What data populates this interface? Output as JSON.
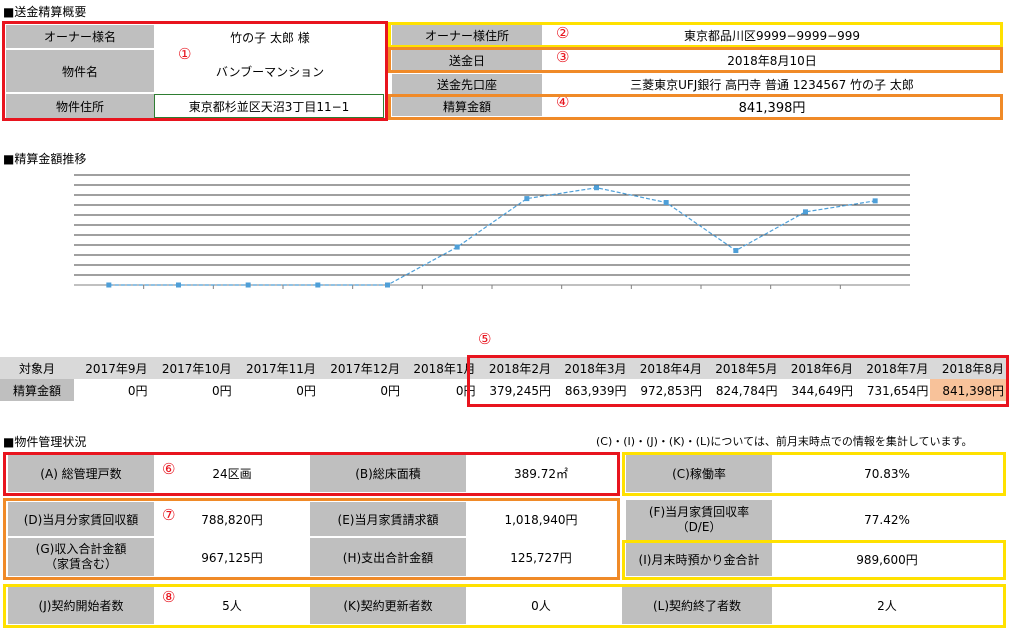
{
  "sections": {
    "remittance_title": "■送金精算概要",
    "trend_title": "■精算金額推移",
    "mgmt_title": "■物件管理状況",
    "mgmt_note": "(C)・(I)・(J)・(K)・(L)については、前月末時点での情報を集計しています。"
  },
  "markers": {
    "m1": "①",
    "m2": "②",
    "m3": "③",
    "m4": "④",
    "m5": "⑤",
    "m6": "⑥",
    "m7": "⑦",
    "m8": "⑧"
  },
  "summary": {
    "owner_name_label": "オーナー様名",
    "owner_name": "竹の子 太郎 様",
    "property_name_label": "物件名",
    "property_name": "バンブーマンション",
    "property_address_label": "物件住所",
    "property_address": "東京都杉並区天沼3丁目11−1",
    "owner_address_label": "オーナー様住所",
    "owner_address": "東京都品川区9999−9999−999",
    "remit_date_label": "送金日",
    "remit_date": "2018年8月10日",
    "remit_account_label": "送金先口座",
    "remit_account": "三菱東京UFJ銀行 高円寺 普通 1234567 竹の子 太郎",
    "settlement_label": "精算金額",
    "settlement_amount": "841,398円"
  },
  "monthly": {
    "row1_label": "対象月",
    "row2_label": "精算金額",
    "months": [
      "2017年9月",
      "2017年10月",
      "2017年11月",
      "2017年12月",
      "2018年1月",
      "2018年2月",
      "2018年3月",
      "2018年4月",
      "2018年5月",
      "2018年6月",
      "2018年7月",
      "2018年8月"
    ],
    "amounts": [
      "0円",
      "0円",
      "0円",
      "0円",
      "0円",
      "379,245円",
      "863,939円",
      "972,853円",
      "824,784円",
      "344,649円",
      "731,654円",
      "841,398円"
    ]
  },
  "chart_data": {
    "type": "line",
    "title": "",
    "xlabel": "",
    "ylabel": "",
    "categories": [
      "2017年9月",
      "2017年10月",
      "2017年11月",
      "2017年12月",
      "2018年1月",
      "2018年2月",
      "2018年3月",
      "2018年4月",
      "2018年5月",
      "2018年6月",
      "2018年7月",
      "2018年8月"
    ],
    "values": [
      0,
      0,
      0,
      0,
      0,
      379245,
      863939,
      972853,
      824784,
      344649,
      731654,
      841398
    ],
    "ylim": [
      0,
      1100000
    ],
    "grid": true,
    "color": "#4e9fd8"
  },
  "management": {
    "a_label": "(A) 総管理戸数",
    "a_value": "24区画",
    "b_label": "(B)総床面積",
    "b_value": "389.72㎡",
    "c_label": "(C)稼働率",
    "c_value": "70.83%",
    "d_label": "(D)当月分家賃回収額",
    "d_value": "788,820円",
    "e_label": "(E)当月家賃請求額",
    "e_value": "1,018,940円",
    "f_label_1": "(F)当月家賃回収率",
    "f_label_2": "（D/E）",
    "f_value": "77.42%",
    "g_label_1": "(G)収入合計金額",
    "g_label_2": "（家賃含む）",
    "g_value": "967,125円",
    "h_label": "(H)支出合計金額",
    "h_value": "125,727円",
    "i_label": "(I)月末時預かり金合計",
    "i_value": "989,600円",
    "j_label": "(J)契約開始者数",
    "j_value": "5人",
    "k_label": "(K)契約更新者数",
    "k_value": "0人",
    "l_label": "(L)契約終了者数",
    "l_value": "2人"
  }
}
